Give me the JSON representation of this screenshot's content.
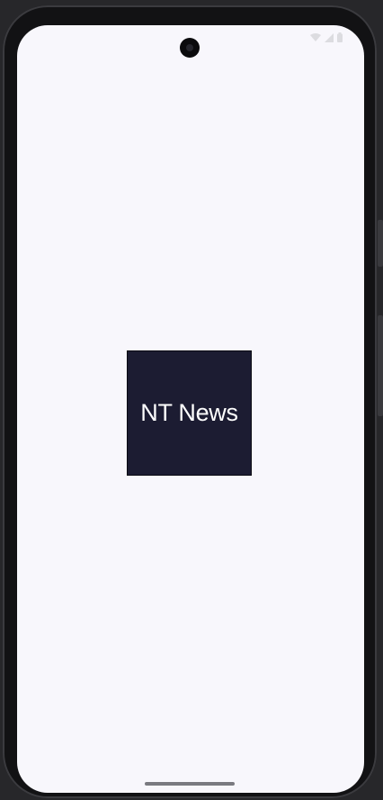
{
  "status_bar": {
    "time": "",
    "icons": [
      "wifi-icon",
      "signal-icon",
      "battery-icon"
    ]
  },
  "splash": {
    "logo_text": "NT News",
    "logo_background": "#1c1c32",
    "screen_background": "#f8f7fc"
  }
}
